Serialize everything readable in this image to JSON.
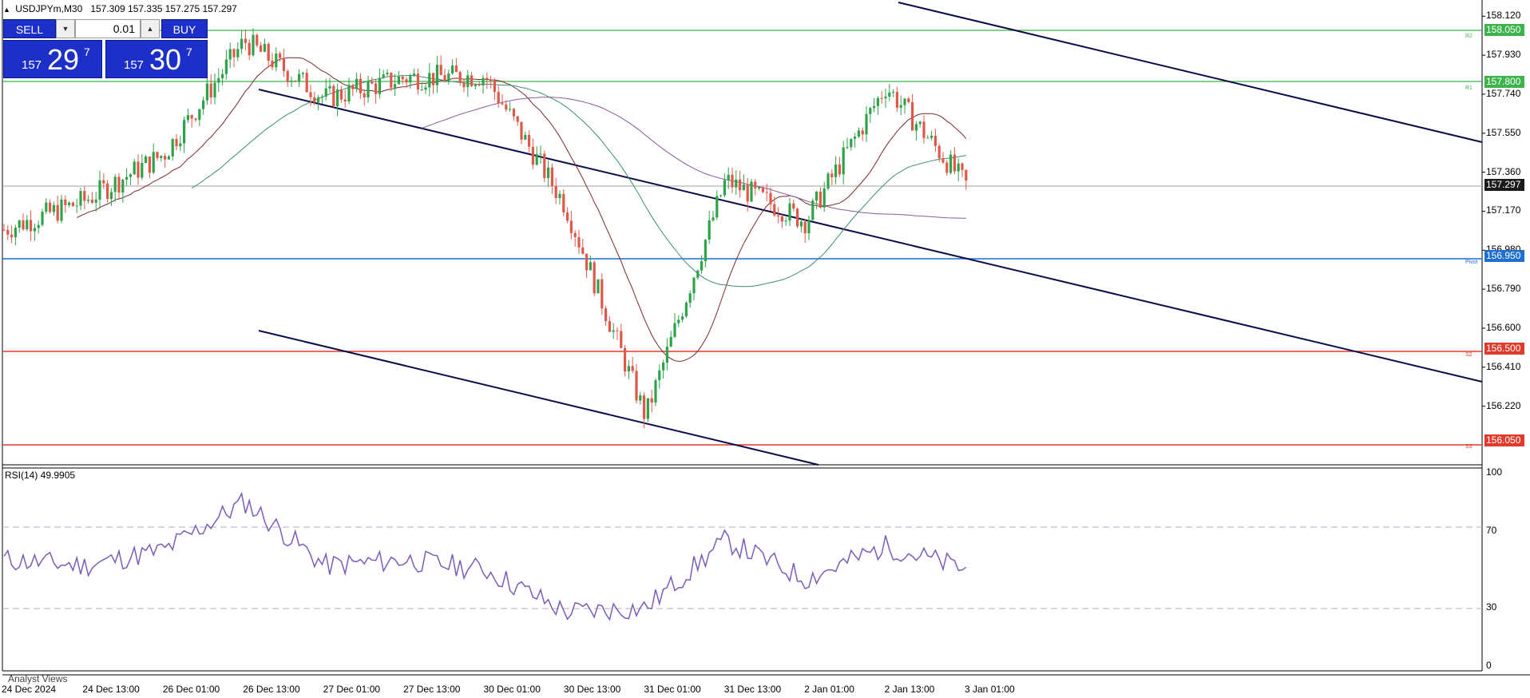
{
  "header": {
    "symbol_line": "USDJPYm,M30",
    "ohlc": "157.309 157.335 157.275 157.297"
  },
  "trade_panel": {
    "sell_label": "SELL",
    "buy_label": "BUY",
    "lot_value": "0.01",
    "sell_quote": {
      "small": "157",
      "big": "29",
      "sup": "7"
    },
    "buy_quote": {
      "small": "157",
      "big": "30",
      "sup": "7"
    }
  },
  "price_axis": {
    "ticks": [
      "158.120",
      "157.930",
      "157.740",
      "157.550",
      "157.360",
      "157.170",
      "156.980",
      "156.790",
      "156.600",
      "156.410",
      "156.220"
    ],
    "current_price": "157.297"
  },
  "levels": [
    {
      "name": "R2",
      "price": "158.050",
      "color": "#3cb44b"
    },
    {
      "name": "R1",
      "price": "157.800",
      "color": "#3cb44b"
    },
    {
      "name": "Pivot",
      "price": "156.950",
      "color": "#1f6fd1"
    },
    {
      "name": "S2",
      "price": "156.500",
      "color": "#e03b2c"
    },
    {
      "name": "S3",
      "price": "156.050",
      "color": "#e03b2c"
    }
  ],
  "rsi": {
    "title": "RSI(14) 49.9905",
    "axis_labels": [
      "100",
      "70",
      "30",
      "0"
    ]
  },
  "time_axis": [
    "24 Dec 2024",
    "24 Dec 13:00",
    "26 Dec 01:00",
    "26 Dec 13:00",
    "27 Dec 01:00",
    "27 Dec 13:00",
    "30 Dec 01:00",
    "30 Dec 13:00",
    "31 Dec 01:00",
    "31 Dec 13:00",
    "2 Jan 01:00",
    "2 Jan 13:00",
    "3 Jan 01:00"
  ],
  "bottom_tab": "Analyst Views",
  "chart_data": {
    "type": "candlestick",
    "symbol": "USDJPYm",
    "timeframe": "M30",
    "y_range": [
      155.95,
      158.16
    ],
    "anchor_series": {
      "times": [
        "24 Dec 2024",
        "24 Dec 13:00",
        "26 Dec 01:00",
        "26 Dec 13:00",
        "27 Dec 01:00",
        "27 Dec 13:00",
        "30 Dec 01:00",
        "30 Dec 13:00",
        "31 Dec 01:00",
        "31 Dec 13:00",
        "2 Jan 01:00",
        "2 Jan 13:00",
        "3 Jan 01:00"
      ],
      "approx_close": [
        157.08,
        157.22,
        157.45,
        158.0,
        157.72,
        157.82,
        157.83,
        157.2,
        156.17,
        157.32,
        157.12,
        157.78,
        157.297
      ]
    },
    "rsi_anchor": [
      55,
      52,
      60,
      85,
      52,
      55,
      50,
      28,
      30,
      65,
      45,
      62,
      50
    ]
  }
}
